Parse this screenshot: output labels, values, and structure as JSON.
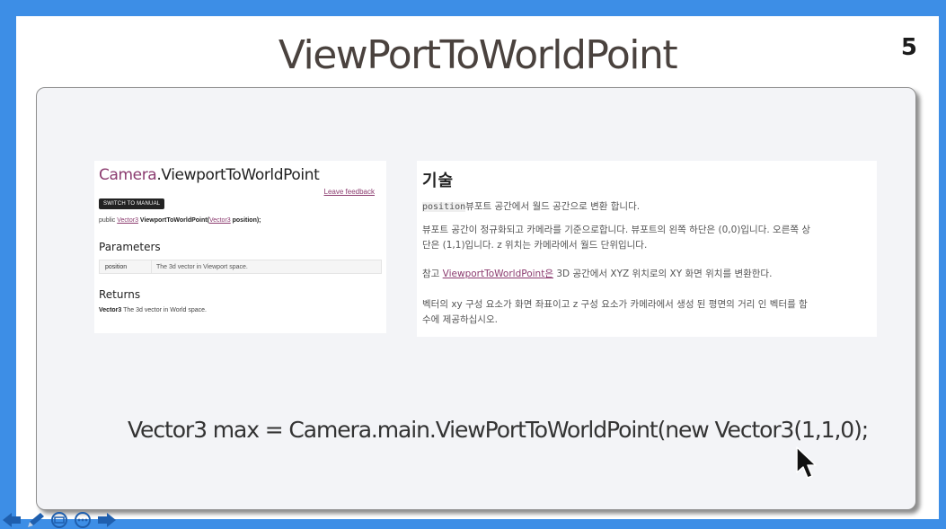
{
  "slide": {
    "title": "ViewPortToWorldPoint",
    "number": "5"
  },
  "doc_en": {
    "class_name": "Camera",
    "method_name": ".ViewportToWorldPoint",
    "feedback_link": "Leave feedback",
    "switch_button": "SWITCH TO MANUAL",
    "signature": {
      "prefix": "public ",
      "return_type": "Vector3",
      "name": " ViewportToWorldPoint(",
      "param_type": "Vector3",
      "suffix": " position);"
    },
    "parameters_heading": "Parameters",
    "parameter": {
      "name": "position",
      "description": "The 3d vector in Viewport space."
    },
    "returns_heading": "Returns",
    "returns": {
      "type": "Vector3",
      "description": " The 3d vector in World space."
    }
  },
  "doc_ko": {
    "heading": "기술",
    "p1_code": "position",
    "p1_text": "뷰포트 공간에서 월드 공간으로 변환 합니다.",
    "p2_line1": "뷰포트 공간이 정규화되고 카메라를 기준으로합니다. 뷰포트의 왼쪽 하단은 (0,0)입니다. 오른쪽 상",
    "p2_line2": "단은 (1,1)입니다. z 위치는 카메라에서 월드 단위입니다.",
    "p3_prefix": "참고 ",
    "p3_link": "ViewportToWorldPoint은",
    "p3_suffix": " 3D 공간에서 XYZ 위치로의 XY 화면 위치를 변환한다.",
    "p4_line1": "벡터의 xy 구성 요소가 화면 좌표이고 z 구성 요소가 카메라에서 생성 된 평면의 거리 인 벡터를 함",
    "p4_line2": "수에 제공하십시오."
  },
  "code_line": "Vector3 max = Camera.main.ViewPortToWorldPoint(new Vector3(1,1,0);",
  "colors": {
    "frame": "#3d8ee6",
    "accent": "#8b3b6f",
    "nav": "#1f5fae"
  },
  "nav_icons": [
    "arrow-left-icon",
    "pen-icon",
    "slides-icon",
    "more-icon",
    "arrow-right-icon"
  ]
}
